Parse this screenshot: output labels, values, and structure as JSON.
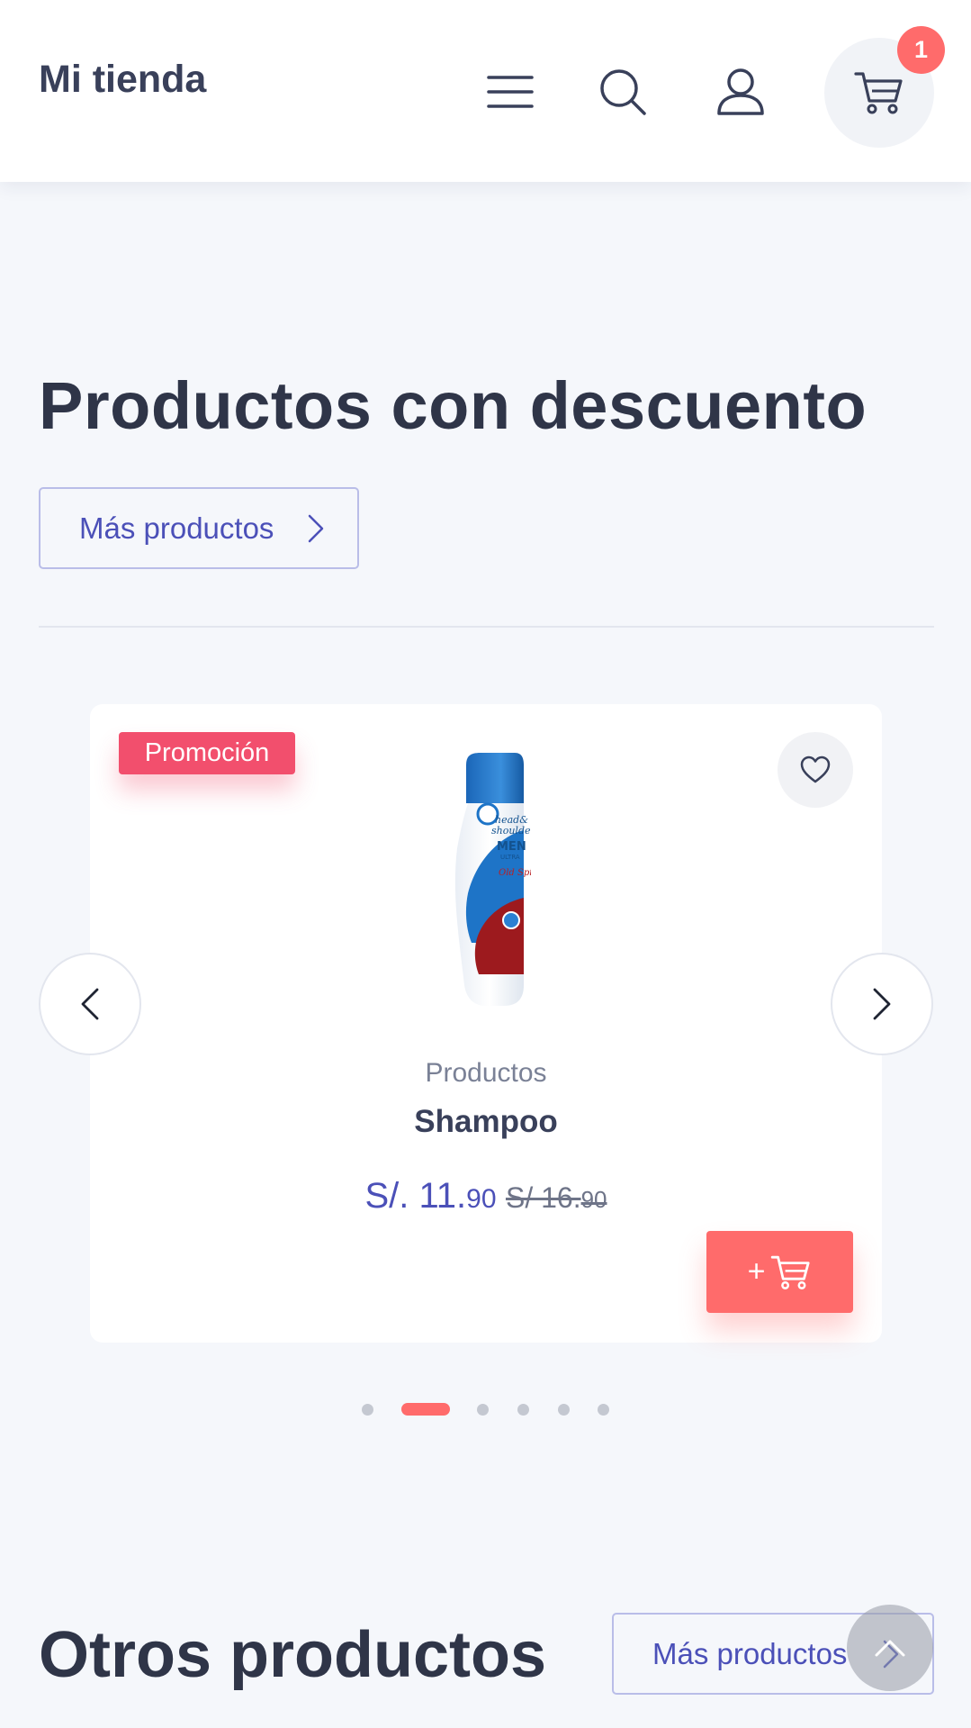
{
  "header": {
    "brand": "Mi tienda",
    "cart_count": "1",
    "icons": [
      "menu-icon",
      "search-icon",
      "user-icon",
      "cart-icon"
    ]
  },
  "discount_section": {
    "title": "Productos con descuento",
    "more_label": "Más productos"
  },
  "product": {
    "badge": "Promoción",
    "category": "Productos",
    "name": "Shampoo",
    "price_currency": "S/.",
    "price_int": " 11.",
    "price_dec": "90",
    "old_price_int": "S/ 16.",
    "old_price_dec": "90",
    "add_label": "+"
  },
  "carousel": {
    "dot_count": 6,
    "active_index": 1
  },
  "other_section": {
    "title": "Otros productos",
    "more_label": "Más productos"
  },
  "colors": {
    "accent": "#4b50b8",
    "cta": "#ff6b6b",
    "badge": "#f24f6d",
    "background": "#f5f7fb"
  }
}
